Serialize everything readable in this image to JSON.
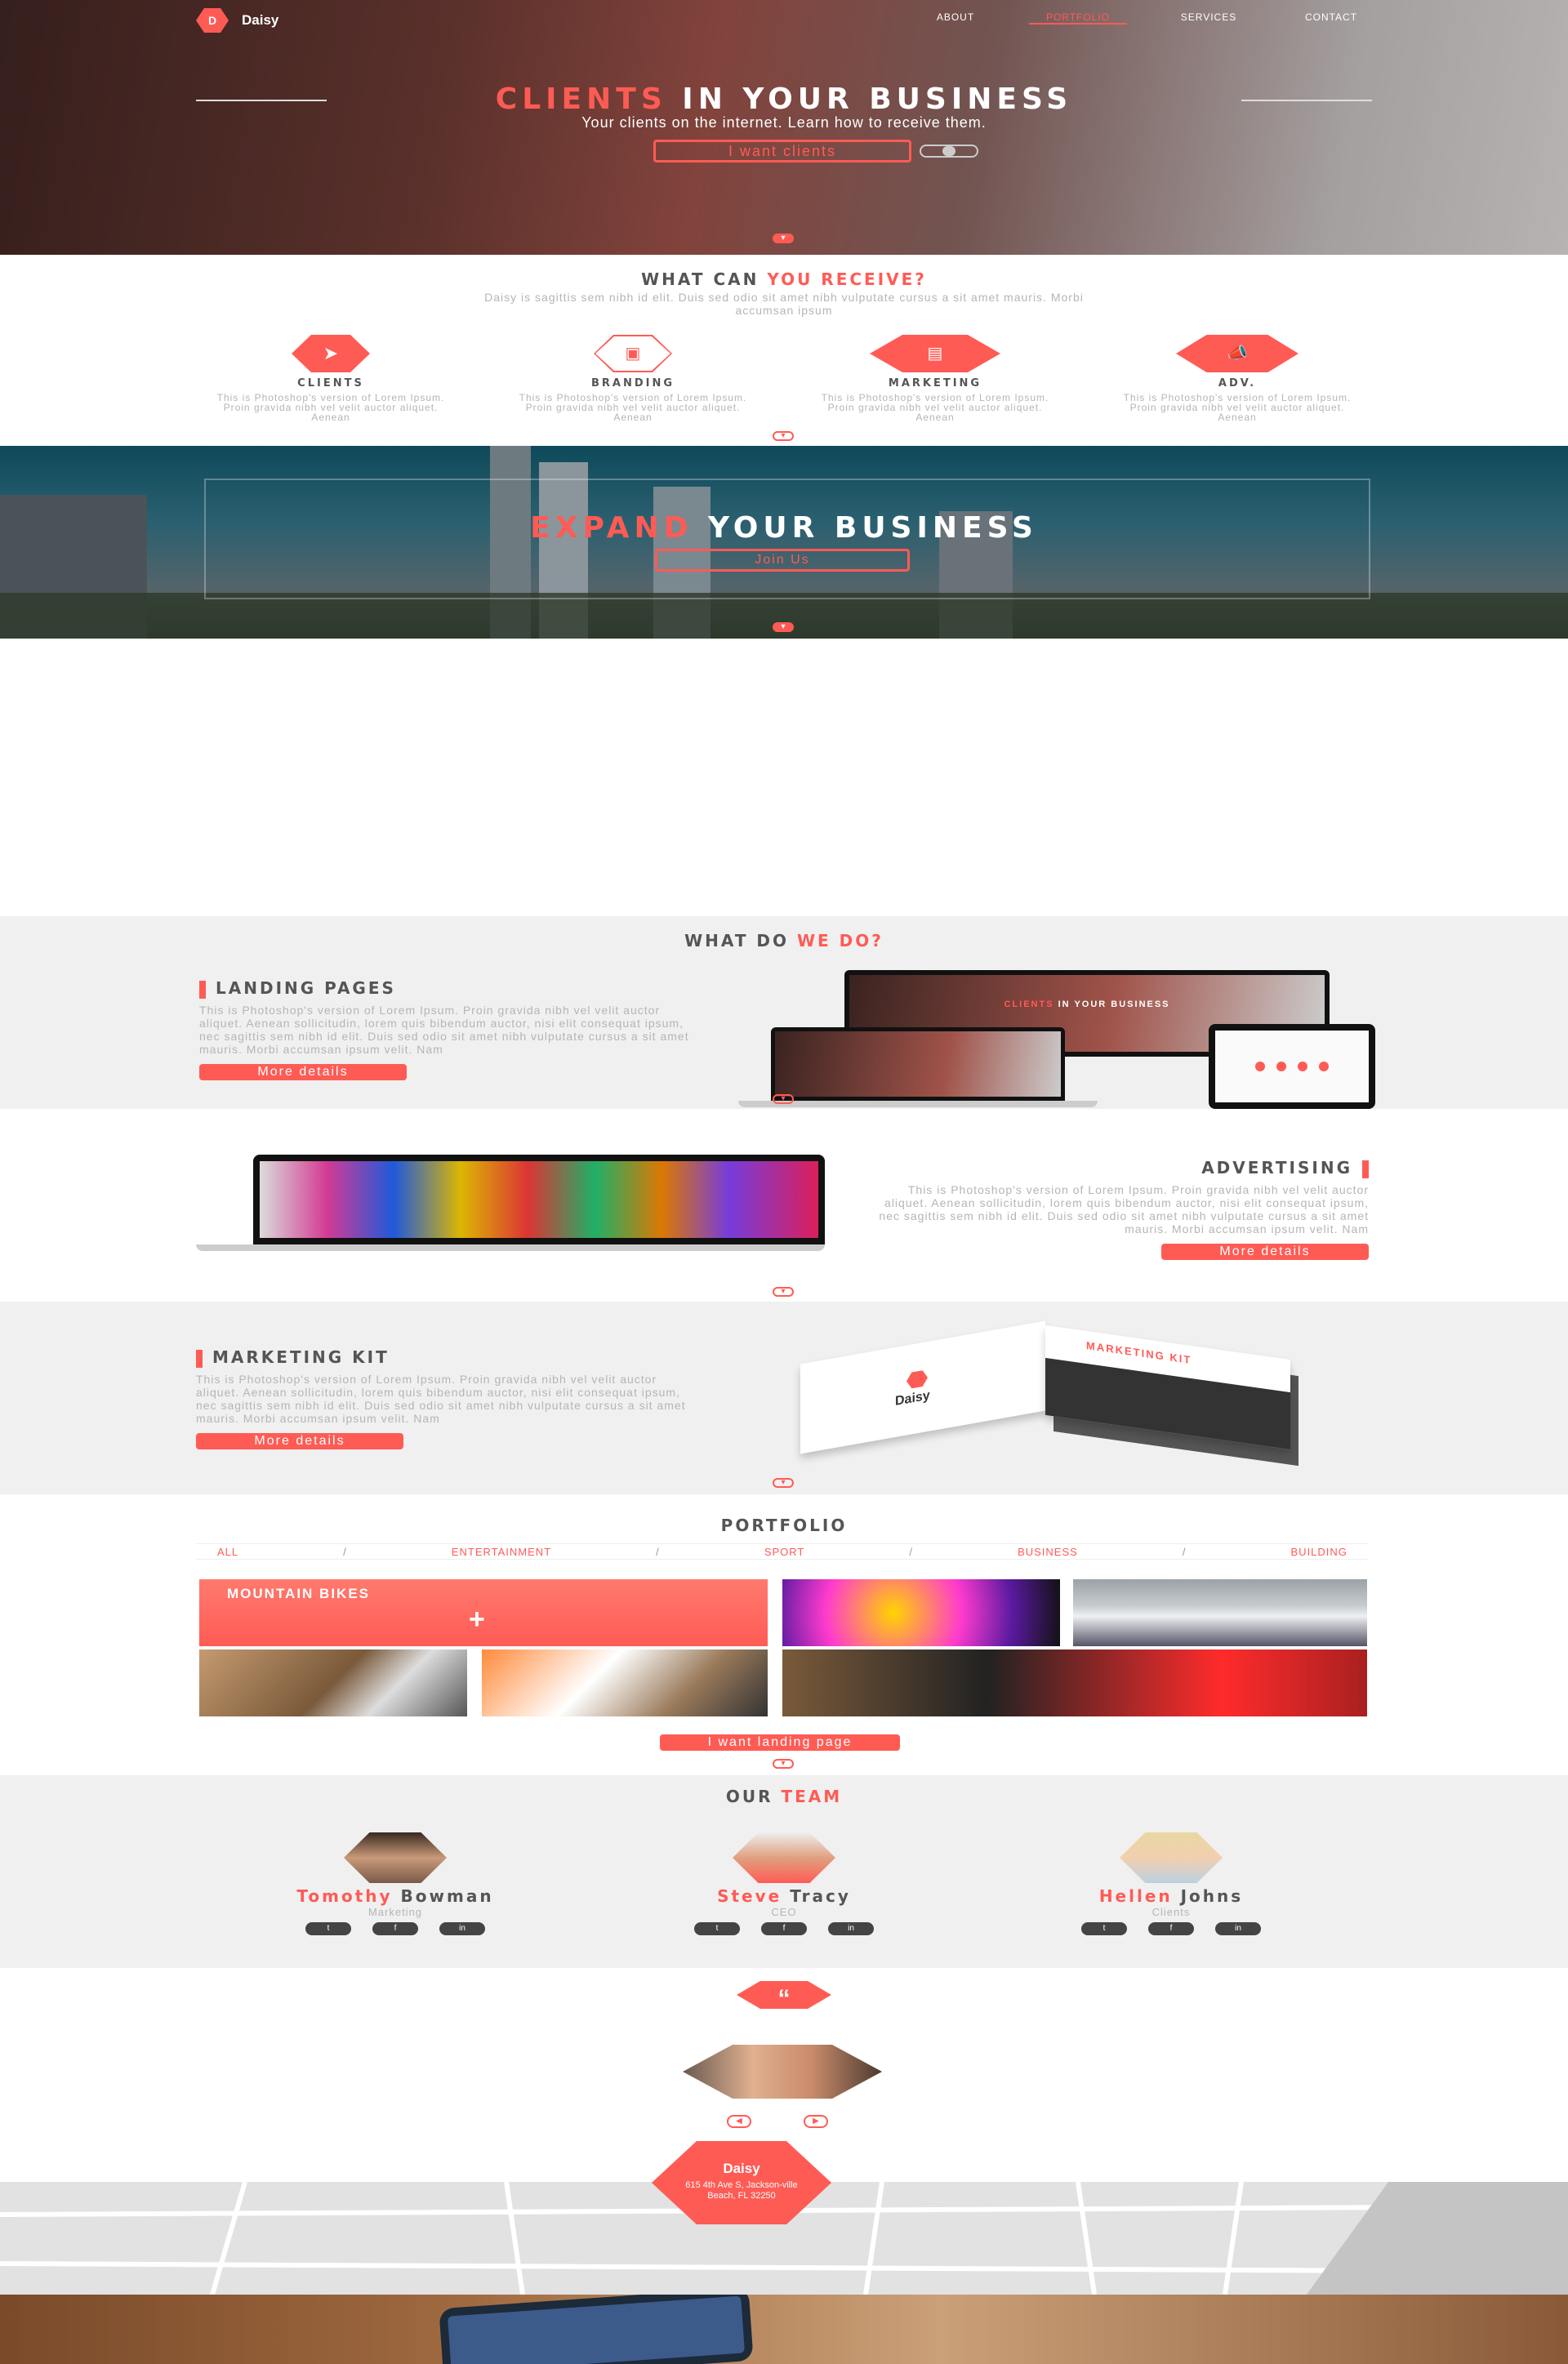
{
  "nav": {
    "logo_letter": "D",
    "logo_text": "Daisy",
    "items": [
      "ABOUT",
      "PORTFOLIO",
      "SERVICES",
      "CONTACT"
    ],
    "active": "PORTFOLIO"
  },
  "hero": {
    "title_accent": "CLIENTS",
    "title_rest": " IN YOUR BUSINESS",
    "subtitle": "Your clients on the internet. Learn how to receive them.",
    "button": "I want clients"
  },
  "receive": {
    "title_plain": "WHAT CAN ",
    "title_accent": "YOU RECEIVE?",
    "text": "Daisy is sagittis sem nibh id elit. Duis sed odio sit amet nibh vulputate cursus a sit amet mauris. Morbi accumsan ipsum",
    "features": [
      {
        "icon": "rocket-icon",
        "title": "CLIENTS",
        "text": "This is Photoshop's version of Lorem Ipsum. Proin gravida nibh vel velit auctor aliquet. Aenean"
      },
      {
        "icon": "monitor-icon",
        "title": "BRANDING",
        "text": "This is Photoshop's version of Lorem Ipsum. Proin gravida nibh vel velit auctor aliquet. Aenean"
      },
      {
        "icon": "presentation-icon",
        "title": "MARKETING",
        "text": "This is Photoshop's version of Lorem Ipsum. Proin gravida nibh vel velit auctor aliquet. Aenean"
      },
      {
        "icon": "megaphone-icon",
        "title": "ADV.",
        "text": "This is Photoshop's version of Lorem Ipsum. Proin gravida nibh vel velit auctor aliquet. Aenean"
      }
    ]
  },
  "expand": {
    "title_accent": "EXPAND",
    "title_rest": " YOUR BUSINESS",
    "button": "Join Us"
  },
  "services": {
    "title_plain": "WHAT DO ",
    "title_accent": "WE DO?",
    "landing": {
      "title": "LANDING PAGES",
      "text": "This is Photoshop's version of Lorem Ipsum. Proin gravida nibh vel velit auctor aliquet. Aenean sollicitudin, lorem quis bibendum auctor, nisi elit consequat ipsum, nec sagittis sem nibh id elit. Duis sed odio sit amet nibh vulputate cursus a sit amet mauris. Morbi accumsan ipsum velit. Nam",
      "button": "More details",
      "mock_title_accent": "CLIENTS",
      "mock_title_rest": " IN YOUR BUSINESS"
    },
    "advertising": {
      "title": "ADVERTISING",
      "text": "This is Photoshop's version of Lorem Ipsum. Proin gravida nibh vel velit auctor aliquet. Aenean sollicitudin, lorem quis bibendum auctor, nisi elit consequat ipsum, nec sagittis sem nibh id elit. Duis sed odio sit amet nibh vulputate cursus a sit amet mauris. Morbi accumsan ipsum velit. Nam",
      "button": "More details"
    },
    "marketing": {
      "title": "MARKETING KIT",
      "text": "This is Photoshop's version of Lorem Ipsum. Proin gravida nibh vel velit auctor aliquet. Aenean sollicitudin, lorem quis bibendum auctor, nisi elit consequat ipsum, nec sagittis sem nibh id elit. Duis sed odio sit amet nibh vulputate cursus a sit amet mauris. Morbi accumsan ipsum velit. Nam",
      "button": "More details",
      "kit_label": "MARKETING KIT",
      "kit_logo": "Daisy"
    }
  },
  "portfolio": {
    "title": "PORTFOLIO",
    "filters": [
      "ALL",
      "ENTERTAINMENT",
      "SPORT",
      "BUSINESS",
      "BUILDING"
    ],
    "feature_label": "MOUNTAIN BIKES",
    "button": "I want landing page"
  },
  "team": {
    "title_plain": "OUR ",
    "title_accent": "TEAM",
    "members": [
      {
        "first": "Tomothy",
        "last": " Bowman",
        "role": "Marketing"
      },
      {
        "first": "Steve",
        "last": " Tracy",
        "role": "CEO"
      },
      {
        "first": "Hellen",
        "last": " Johns",
        "role": "Clients"
      }
    ],
    "socials": [
      "twitter-icon",
      "facebook-icon",
      "linkedin-icon"
    ]
  },
  "testimonial": {
    "quote_icon": "quote-icon"
  },
  "contact": {
    "name": "Daisy",
    "address": "615 4th Ave S, Jackson-ville Beach, FL 32250"
  },
  "colors": {
    "accent": "#ff5b55",
    "light_gray": "#f0f0f0",
    "dark_text": "#444444"
  }
}
